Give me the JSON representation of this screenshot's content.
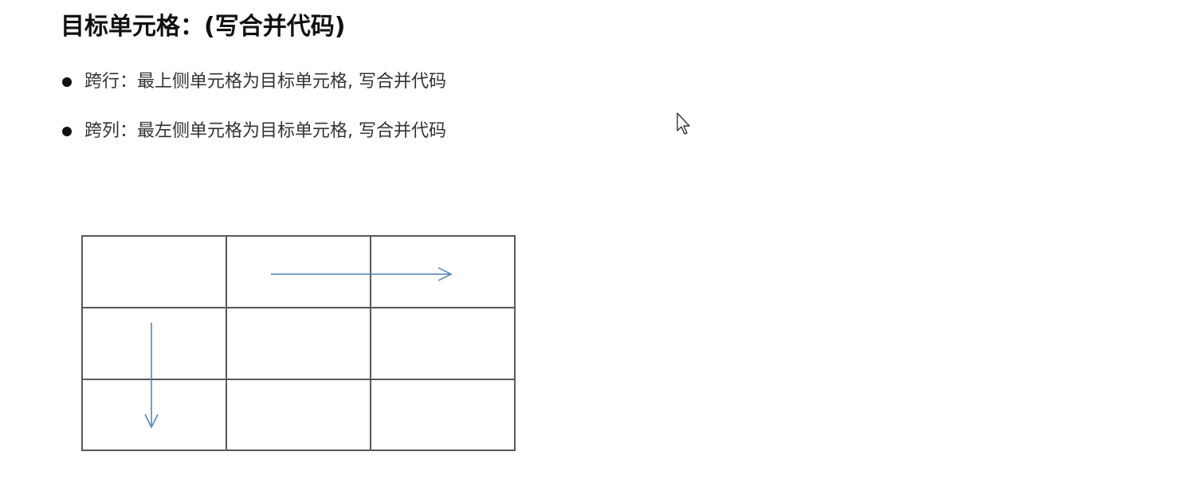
{
  "slide": {
    "title": "目标单元格：(写合并代码)",
    "bullets": [
      {
        "text": "跨行：最上侧单元格为目标单元格, 写合并代码"
      },
      {
        "text": "跨列：最左侧单元格为目标单元格, 写合并代码"
      }
    ]
  },
  "diagram": {
    "rows": 3,
    "columns": 3,
    "line_color": "#595959",
    "arrow_color": "#4f7fb8",
    "arrows": [
      {
        "direction": "right",
        "meaning": "horizontal span across top row"
      },
      {
        "direction": "down",
        "meaning": "vertical span down first column"
      }
    ]
  },
  "icons": {
    "bullet": "bullet-dot-icon",
    "cursor": "mouse-pointer-icon"
  }
}
